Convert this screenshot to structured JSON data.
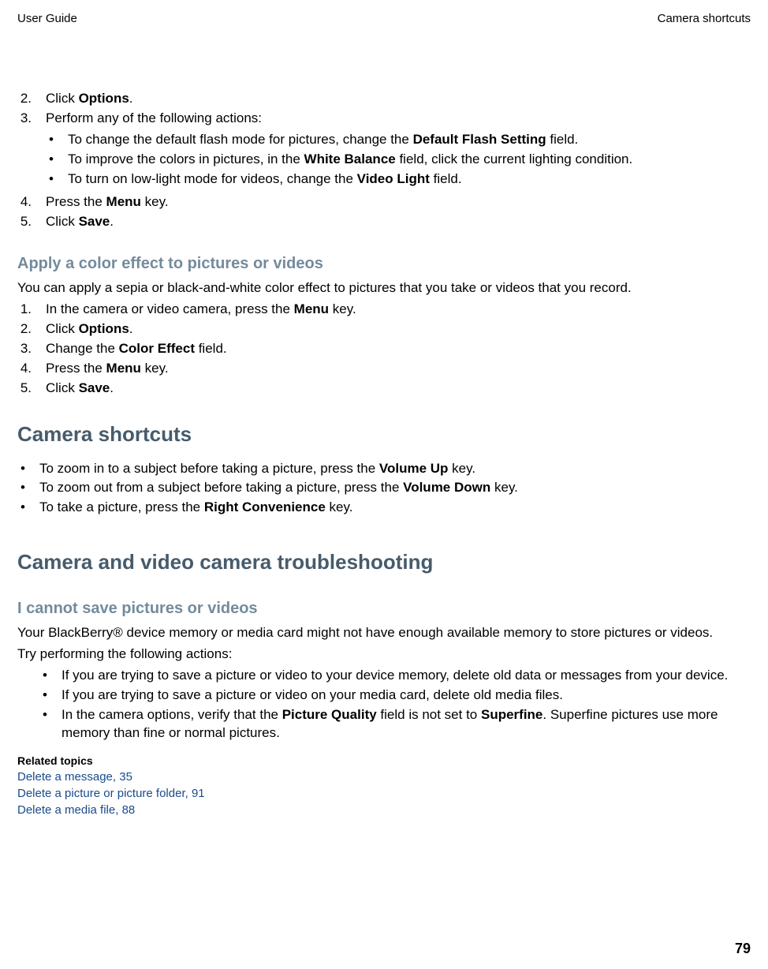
{
  "header": {
    "left": "User Guide",
    "right": "Camera shortcuts"
  },
  "top_list": {
    "items": [
      {
        "num": "2.",
        "pre": "Click ",
        "bold": "Options",
        "post": "."
      },
      {
        "num": "3.",
        "pre": "Perform any of the following actions:",
        "bold": "",
        "post": "",
        "sub": [
          {
            "pre": "To change the default flash mode for pictures, change the ",
            "bold": "Default Flash Setting",
            "post": " field."
          },
          {
            "pre": "To improve the colors in pictures, in the ",
            "bold": "White Balance",
            "post": " field, click the current lighting condition."
          },
          {
            "pre": "To turn on low-light mode for videos, change the ",
            "bold": "Video Light",
            "post": "  field."
          }
        ]
      },
      {
        "num": "4.",
        "pre": "Press the ",
        "bold": "Menu",
        "post": " key."
      },
      {
        "num": "5.",
        "pre": "Click ",
        "bold": "Save",
        "post": "."
      }
    ]
  },
  "h_effect": "Apply a color effect to pictures or videos",
  "effect_intro": "You can apply a sepia or black-and-white color effect to pictures that you take or videos that you record.",
  "effect_list": {
    "items": [
      {
        "num": "1.",
        "pre": "In the camera or video camera, press the ",
        "bold": "Menu",
        "post": " key."
      },
      {
        "num": "2.",
        "pre": "Click ",
        "bold": "Options",
        "post": "."
      },
      {
        "num": "3.",
        "pre": "Change the ",
        "bold": "Color Effect",
        "post": " field."
      },
      {
        "num": "4.",
        "pre": "Press the ",
        "bold": "Menu",
        "post": " key."
      },
      {
        "num": "5.",
        "pre": "Click ",
        "bold": "Save",
        "post": "."
      }
    ]
  },
  "h_shortcuts": "Camera shortcuts",
  "shortcuts": [
    {
      "pre": "To zoom in to a subject before taking a picture, press the ",
      "bold": "Volume Up",
      "post": " key."
    },
    {
      "pre": "To zoom out from a subject before taking a picture, press the ",
      "bold": "Volume Down",
      "post": " key."
    },
    {
      "pre": "To take a picture, press the ",
      "bold": "Right Convenience",
      "post": " key."
    }
  ],
  "h_trouble": "Camera and video camera troubleshooting",
  "h_cannot": "I cannot save pictures or videos",
  "cannot_p1": "Your BlackBerry® device memory or media card might not have enough available memory to store pictures or videos.",
  "cannot_p2": "Try performing the following actions:",
  "cannot_list": [
    {
      "pre": "If you are trying to save a picture or video to your device memory, delete old data or messages from your device.",
      "bold": "",
      "post": ""
    },
    {
      "pre": "If you are trying to save a picture or video on your media card, delete old media files.",
      "bold": "",
      "post": ""
    },
    {
      "pre": "In the camera options, verify that the ",
      "bold": "Picture Quality",
      "post_pre": " field is not set to ",
      "bold2": "Superfine",
      "post": ". Superfine pictures use more memory than fine or normal pictures."
    }
  ],
  "related_h": "Related topics",
  "related": [
    "Delete a message, 35",
    "Delete a picture or picture folder, 91",
    "Delete a media file, 88"
  ],
  "page_number": "79"
}
